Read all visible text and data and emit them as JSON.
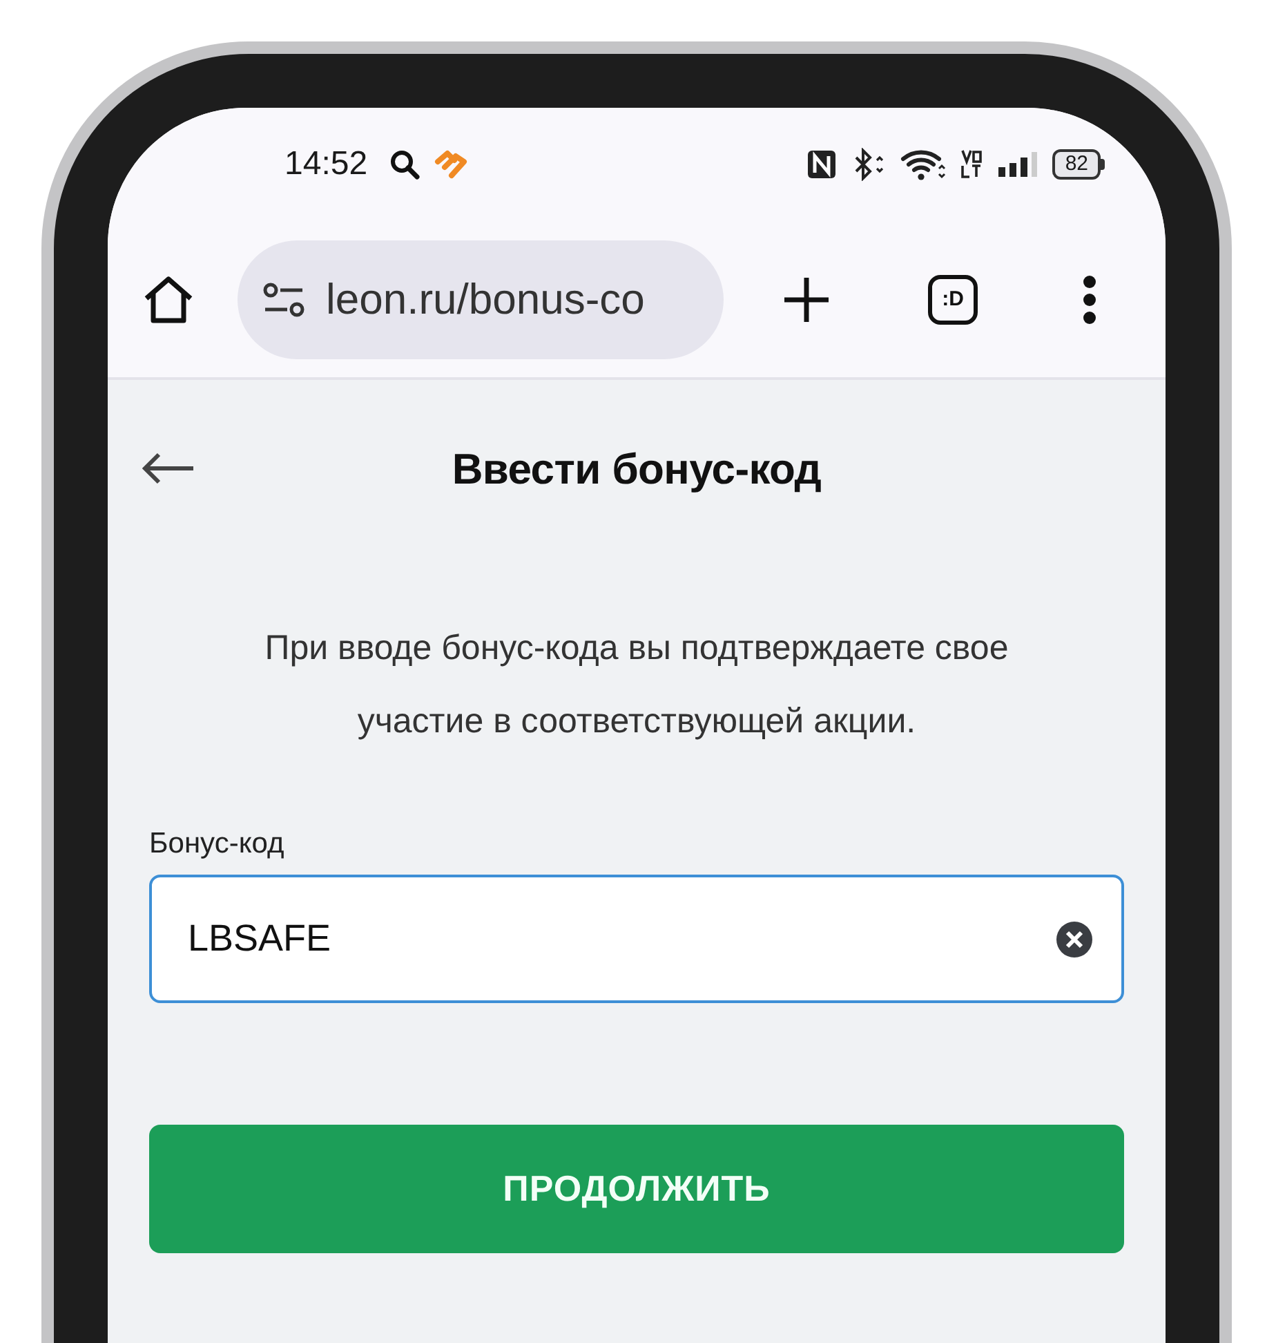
{
  "status_bar": {
    "time": "14:52",
    "battery": "82"
  },
  "browser": {
    "url": "leon.ru/bonus-co",
    "tabs_label": ":D"
  },
  "page": {
    "title": "Ввести бонус-код",
    "description": "При вводе бонус-кода вы подтверждаете свое участие в соответствующей акции.",
    "field": {
      "label": "Бонус-код",
      "value": "LBSAFE",
      "focused": true
    },
    "submit_button": "ПРОДОЛЖИТЬ"
  }
}
